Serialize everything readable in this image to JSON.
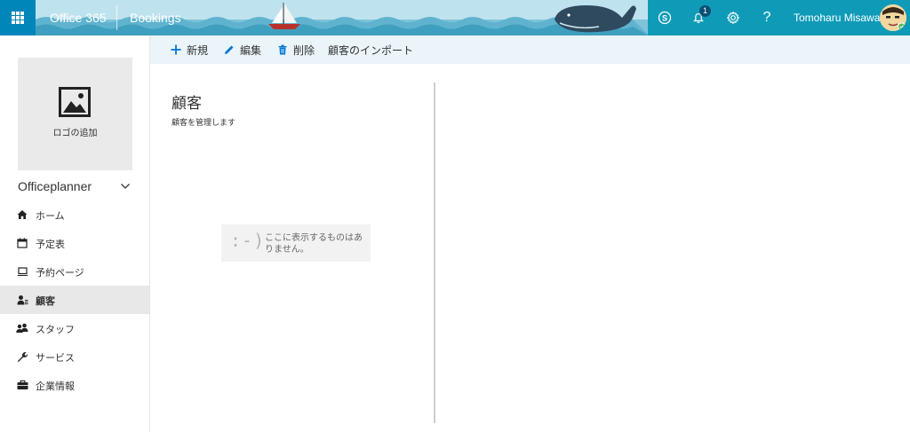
{
  "suite_bar": {
    "brand": "Office 365",
    "app_name": "Bookings",
    "notification_count": "1",
    "user_name": "Tomoharu Misawa",
    "accent_color": "#0086b8"
  },
  "command_bar": {
    "new_label": "新規",
    "edit_label": "編集",
    "delete_label": "削除",
    "import_label": "顧客のインポート"
  },
  "sidebar": {
    "logo_label": "ロゴの追加",
    "business_name": "Officeplanner",
    "items": [
      {
        "label": "ホーム",
        "icon": "home-icon"
      },
      {
        "label": "予定表",
        "icon": "calendar-icon"
      },
      {
        "label": "予約ページ",
        "icon": "laptop-icon"
      },
      {
        "label": "顧客",
        "icon": "customer-icon",
        "active": true
      },
      {
        "label": "スタッフ",
        "icon": "staff-icon"
      },
      {
        "label": "サービス",
        "icon": "wrench-icon"
      },
      {
        "label": "企業情報",
        "icon": "briefcase-icon"
      }
    ]
  },
  "main": {
    "title": "顧客",
    "subtitle": "顧客を管理します",
    "empty_face": ":-)",
    "empty_message": "ここに表示するものはありません。"
  }
}
